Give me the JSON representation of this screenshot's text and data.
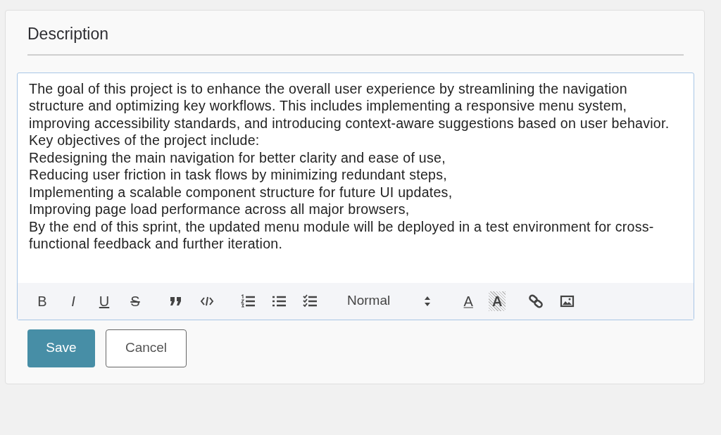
{
  "heading": "Description",
  "editor": {
    "paragraphs": [
      "The goal of this project is to enhance the overall user experience by streamlining the navigation structure and optimizing key workflows. This includes implementing a responsive menu system, improving accessibility standards, and introducing context-aware suggestions based on user behavior. Key objectives of the project include:",
      "Redesigning the main navigation for better clarity and ease of use,",
      "Reducing user friction in task flows by minimizing redundant steps,",
      "Implementing a scalable component structure for future UI updates,",
      "Improving page load performance across all major browsers,",
      "By the end of this sprint, the updated menu module will be deployed in a test environment for cross-functional feedback and further iteration."
    ],
    "toolbar": [
      [
        {
          "kind": "bold",
          "label": "B"
        },
        {
          "kind": "italic",
          "label": "I"
        },
        {
          "kind": "underline",
          "label": "U"
        },
        {
          "kind": "strike",
          "label": "S"
        }
      ],
      [
        {
          "kind": "quote"
        },
        {
          "kind": "code"
        }
      ],
      [
        {
          "kind": "ordered"
        },
        {
          "kind": "bullet"
        },
        {
          "kind": "check"
        }
      ],
      [
        {
          "kind": "select",
          "label": "Normal"
        }
      ],
      [
        {
          "kind": "color",
          "label": "A"
        },
        {
          "kind": "background",
          "label": "A"
        }
      ],
      [
        {
          "kind": "link"
        },
        {
          "kind": "image"
        }
      ]
    ]
  },
  "buttons": [
    {
      "kind": "primary",
      "label": "Save"
    },
    {
      "kind": "secondary",
      "label": "Cancel"
    }
  ]
}
